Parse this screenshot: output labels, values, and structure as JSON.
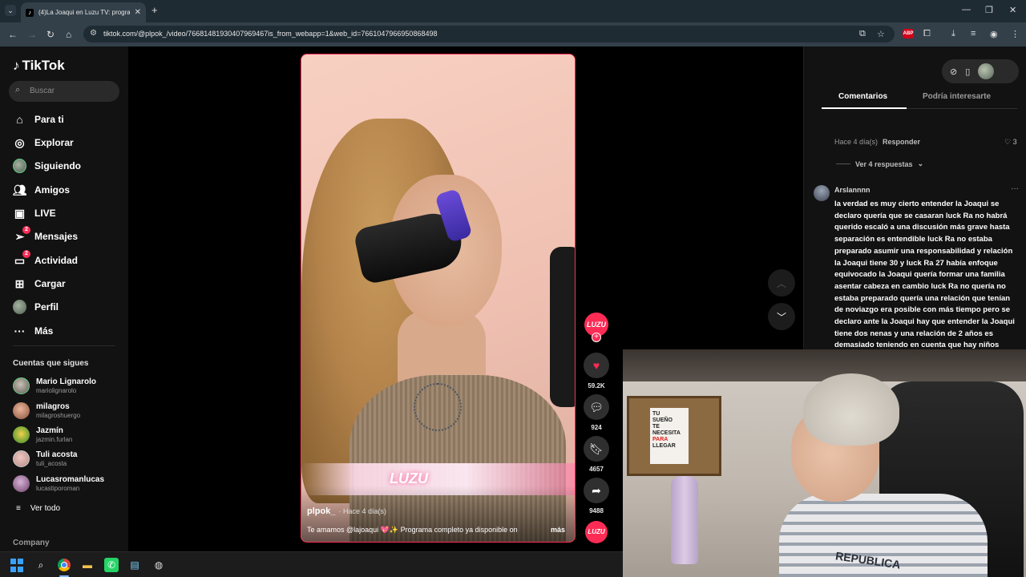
{
  "browser": {
    "tab_title": "(4)La Joaqui en Luzu TV: progra",
    "url": "tiktok.com/@plpok_/video/76681481930407969467is_from_webapp=1&web_id=7661047966950868498",
    "abp_label": "ABP"
  },
  "sidebar": {
    "brand": "TikTok",
    "search_placeholder": "Buscar",
    "nav": [
      {
        "label": "Para ti",
        "icon": "home-icon"
      },
      {
        "label": "Explorar",
        "icon": "compass-icon"
      },
      {
        "label": "Siguiendo",
        "icon": "avatar"
      },
      {
        "label": "Amigos",
        "icon": "friends-icon"
      },
      {
        "label": "LIVE",
        "icon": "live-icon"
      },
      {
        "label": "Mensajes",
        "icon": "paper-plane-icon",
        "badge": "2"
      },
      {
        "label": "Actividad",
        "icon": "activity-icon",
        "badge": "2"
      },
      {
        "label": "Cargar",
        "icon": "plus-square-icon"
      },
      {
        "label": "Perfil",
        "icon": "avatar"
      },
      {
        "label": "Más",
        "icon": "more-icon"
      }
    ],
    "following_title": "Cuentas que sigues",
    "following": [
      {
        "name": "Mario Lignarolo",
        "handle": "mariolignarolo"
      },
      {
        "name": "milagros",
        "handle": "milagroshuergo"
      },
      {
        "name": "Jazmín",
        "handle": "jazmin.furlan"
      },
      {
        "name": "Tuli acosta",
        "handle": "tuli_acosta"
      },
      {
        "name": "Lucasromanlucas",
        "handle": "lucastiporoman"
      }
    ],
    "see_all": "Ver todo",
    "company": "Company"
  },
  "video": {
    "author": "plpok_",
    "posted": "· Hace 4 día(s)",
    "caption": "Te amamos @lajoaqui 💖✨ Programa completo ya disponible on",
    "more": "más",
    "channel_badge": "LUZU",
    "likes": "59.2K",
    "comments": "924",
    "saves": "4657",
    "shares": "9488"
  },
  "comments_panel": {
    "tab_comments": "Comentarios",
    "tab_suggested": "Podría interesarte",
    "prev_meta": "Hace 4 día(s)",
    "reply_label": "Responder",
    "prev_likes": "3",
    "view_replies": "Ver 4 respuestas",
    "comment_user": "Arslannnn",
    "comment_text": "la verdad es muy cierto entender la Joaqui se declaro quería que se casaran luck Ra no habrá querido escaló a una discusión más grave hasta separación es entendible luck Ra no estaba preparado asumir una responsabilidad y relación la Joaqui tiene 30 y luck Ra 27 había enfoque equivocado la Joaqui quería formar una familia asentar cabeza en cambio luck Ra no quería no estaba preparado quería una relación que tenían de noviazgo era posible con más tiempo pero se declaro ante la Joaqui hay que entender la Joaqui tiene dos nenas y una relación de 2 años es demasiado teniendo en cuenta que hay niños"
  },
  "webcam": {
    "poster_line1": "TU",
    "poster_line2": "SUEÑO",
    "poster_line3": "TE",
    "poster_line4": "NECESITA",
    "poster_line5": "PARA",
    "poster_line6": "LLEGAR",
    "shirt_text": "REPUBLICA"
  },
  "colors": {
    "tiktok_red": "#fe2c55",
    "chrome_bg": "#1f2b33"
  }
}
